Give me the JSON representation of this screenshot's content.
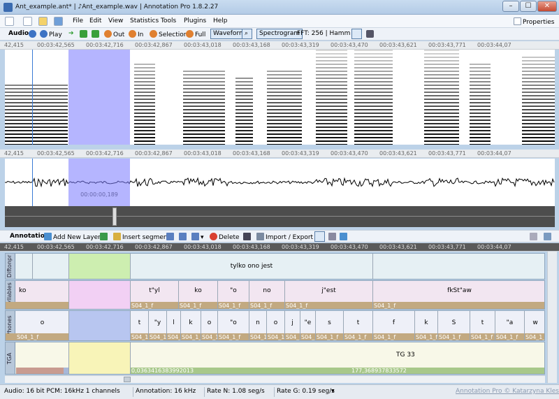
{
  "window": {
    "title_tabs": [
      "Ant_example.ant*",
      "Ant_example.wav"
    ],
    "app_title": "Annotation Pro 1.8.2.27",
    "controls": [
      "–",
      "☐",
      "✕"
    ]
  },
  "menu": [
    "File",
    "Edit",
    "View",
    "Statistics",
    "Tools",
    "Plugins",
    "Help"
  ],
  "properties_label": "Properties",
  "toolbar": {
    "audio": "Audio",
    "play": "Play",
    "zoom_out": "Out",
    "zoom_in": "In",
    "selection": "Selection",
    "full": "Full",
    "waveform": "Waveform",
    "spectrogram": "Spectrogram",
    "fft": "FFT: 256 | Hamm"
  },
  "ruler_ticks": [
    "42,415",
    "00:03:42,565",
    "00:03:42,716",
    "00:03:42,867",
    "00:03:43,018",
    "00:03:43,168",
    "00:03:43,319",
    "00:03:43,470",
    "00:03:43,621",
    "00:03:43,771",
    "00:03:44,07"
  ],
  "selection_duration": "00:00:00,189",
  "annotation_toolbar": {
    "annotation": "Annotation",
    "add_layer": "Add New Layer",
    "insert_segment": "Insert segment",
    "delete": "Delete",
    "import_export": "Import / Export"
  },
  "layers": [
    {
      "name": "Diftonpr",
      "segments": [
        {
          "text": ""
        },
        {
          "text": ""
        },
        {
          "text": "tylko ono jest"
        },
        {
          "text": ""
        }
      ]
    },
    {
      "name": "Syllables",
      "segments": [
        {
          "text": "ko",
          "foot": ""
        },
        {
          "text": "",
          "foot": ""
        },
        {
          "text": "t\"yl",
          "foot": "S04_1_f"
        },
        {
          "text": "ko",
          "foot": "S04_1_f"
        },
        {
          "text": "\"o",
          "foot": "S04_1_f"
        },
        {
          "text": "no",
          "foot": "S04_1_f"
        },
        {
          "text": "j\"est",
          "foot": "S04_1_f"
        },
        {
          "text": "fkSt\"aw",
          "foot": "S04_1_f"
        }
      ]
    },
    {
      "name": "Phones",
      "segments": [
        {
          "text": "o",
          "foot": "S04_1_f"
        },
        {
          "text": "",
          "foot": ""
        },
        {
          "text": "t",
          "foot": "S04_1_f"
        },
        {
          "text": "\"y",
          "foot": "S04_1"
        },
        {
          "text": "l",
          "foot": "S04_1_f"
        },
        {
          "text": "k",
          "foot": "S04_1_f"
        },
        {
          "text": "o",
          "foot": "S04_1_f"
        },
        {
          "text": "\"o",
          "foot": "S04_1_f"
        },
        {
          "text": "n",
          "foot": "S04_1_f"
        },
        {
          "text": "o",
          "foot": "S04_1_f"
        },
        {
          "text": "j",
          "foot": "S04_1"
        },
        {
          "text": "\"e",
          "foot": "S04_1_f"
        },
        {
          "text": "s",
          "foot": "S04_1_f"
        },
        {
          "text": "t",
          "foot": "S04_1_f"
        },
        {
          "text": "f",
          "foot": "S04_1_f"
        },
        {
          "text": "k",
          "foot": "S04_1_f"
        },
        {
          "text": "S",
          "foot": "S04_1_f"
        },
        {
          "text": "t",
          "foot": "S04_1_f"
        },
        {
          "text": "\"a",
          "foot": "S04_1_f"
        },
        {
          "text": "w",
          "foot": "S04_1_f"
        }
      ]
    },
    {
      "name": "TGA",
      "segments": [
        {
          "text": "",
          "foot": ""
        },
        {
          "text": "",
          "foot": ""
        },
        {
          "text": "TG 33",
          "foot": "0,0363416383992013",
          "foot2": "177,368937833572"
        }
      ]
    }
  ],
  "status": {
    "audio": "Audio: 16 bit PCM: 16kHz 1 channels",
    "annotation": "Annotation: 16 kHz",
    "rate_n": "Rate N: 1.08 seg/s",
    "rate_g": "Rate G: 0.19 seg/s",
    "credit": "Annotation Pro ©  Katarzyna Klessa"
  },
  "colors": {
    "selection": "#7878ff",
    "cursor": "#3a7bd5",
    "layer_blue": "#e6f0f4",
    "layer_green_sel": "#cdeeb0",
    "layer_pink": "#f2e6f1",
    "layer_pink_sel": "#f2d0f4",
    "layer_phone": "#eef0f8",
    "layer_phone_sel": "#b8c6f0",
    "layer_tga": "#f8f8e8",
    "layer_tga_sel": "#f8f4b8",
    "foot_bar": "#c2a981"
  }
}
